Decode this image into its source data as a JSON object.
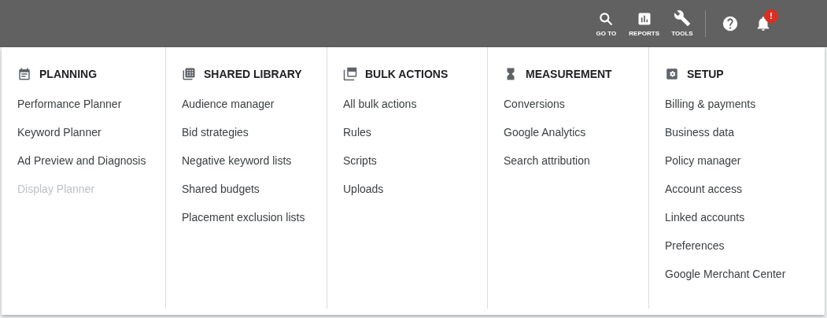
{
  "top_bar": {
    "nav": [
      {
        "label": "GO TO"
      },
      {
        "label": "REPORTS"
      },
      {
        "label": "TOOLS"
      }
    ],
    "notification_badge": "!"
  },
  "menu": {
    "columns": [
      {
        "title": "PLANNING",
        "items": [
          {
            "label": "Performance Planner",
            "disabled": false
          },
          {
            "label": "Keyword Planner",
            "disabled": false
          },
          {
            "label": "Ad Preview and Diagnosis",
            "disabled": false
          },
          {
            "label": "Display Planner",
            "disabled": true
          }
        ]
      },
      {
        "title": "SHARED LIBRARY",
        "items": [
          {
            "label": "Audience manager",
            "disabled": false
          },
          {
            "label": "Bid strategies",
            "disabled": false
          },
          {
            "label": "Negative keyword lists",
            "disabled": false
          },
          {
            "label": "Shared budgets",
            "disabled": false
          },
          {
            "label": "Placement exclusion lists",
            "disabled": false
          }
        ]
      },
      {
        "title": "BULK ACTIONS",
        "items": [
          {
            "label": "All bulk actions",
            "disabled": false
          },
          {
            "label": "Rules",
            "disabled": false
          },
          {
            "label": "Scripts",
            "disabled": false
          },
          {
            "label": "Uploads",
            "disabled": false
          }
        ]
      },
      {
        "title": "MEASUREMENT",
        "items": [
          {
            "label": "Conversions",
            "disabled": false
          },
          {
            "label": "Google Analytics",
            "disabled": false
          },
          {
            "label": "Search attribution",
            "disabled": false
          }
        ]
      },
      {
        "title": "SETUP",
        "items": [
          {
            "label": "Billing & payments",
            "disabled": false
          },
          {
            "label": "Business data",
            "disabled": false
          },
          {
            "label": "Policy manager",
            "disabled": false
          },
          {
            "label": "Account access",
            "disabled": false
          },
          {
            "label": "Linked accounts",
            "disabled": false
          },
          {
            "label": "Preferences",
            "disabled": false
          },
          {
            "label": "Google Merchant Center",
            "disabled": false
          }
        ]
      }
    ]
  }
}
